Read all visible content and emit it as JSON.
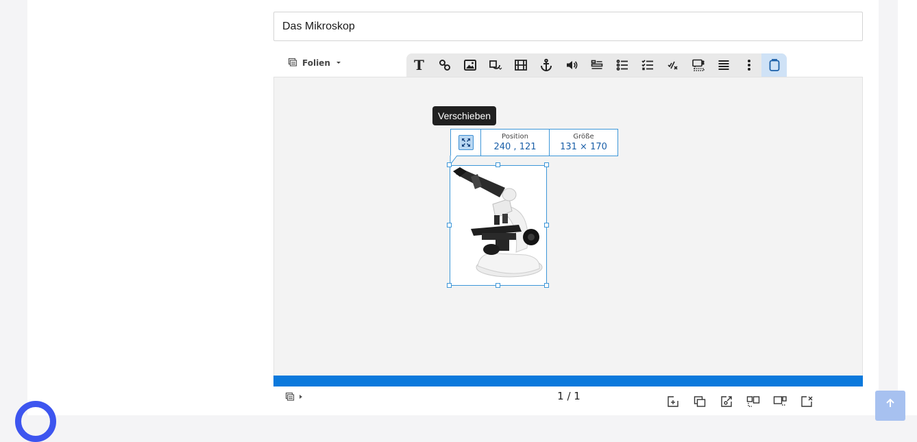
{
  "title_field": {
    "value": "Das Mikroskop"
  },
  "slides_menu": {
    "label": "Folien"
  },
  "toolbar": {
    "icons": [
      "text-icon",
      "link-icon",
      "image-icon",
      "shape-icon",
      "video-icon",
      "anchor-icon",
      "audio-icon",
      "form-icon",
      "list-icon",
      "checklist-icon",
      "formula-icon",
      "selection-icon",
      "list-detail-icon",
      "more-icon",
      "clipboard-icon"
    ],
    "text_glyph": "T",
    "active": "clipboard-icon"
  },
  "tooltip": {
    "text": "Verschieben"
  },
  "element_info": {
    "position_label": "Position",
    "position_value": "240 , 121",
    "size_label": "Größe",
    "size_value": "131 × 170"
  },
  "pagination": {
    "text": "1 / 1"
  },
  "bottom_toolbar": {
    "icons": [
      "add-slide-icon",
      "duplicate-slide-icon",
      "import-slide-icon",
      "slide-layout-icon",
      "slide-template-icon",
      "delete-slide-icon"
    ]
  },
  "colors": {
    "accent": "#0b79dc",
    "selection": "#3c96d8",
    "scroll_top_button": "#a7c1f0",
    "logo_ring": "#3d55ef"
  }
}
